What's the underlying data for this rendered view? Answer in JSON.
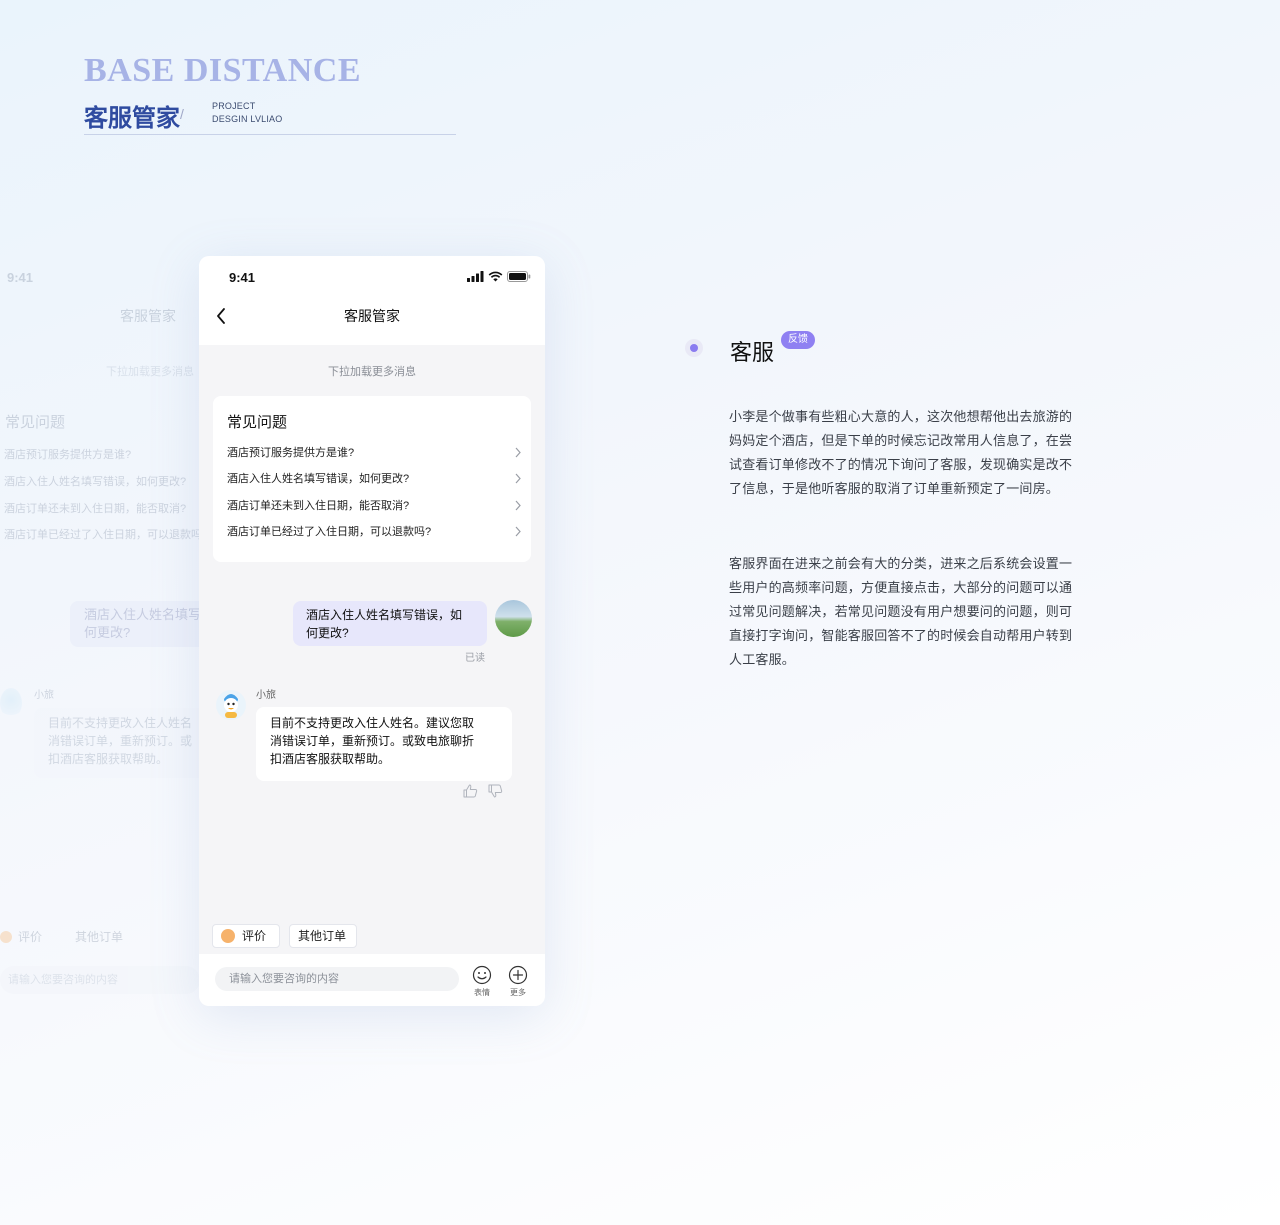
{
  "header": {
    "brand_en": "BASE DISTANCE",
    "brand_cn": "客服管家",
    "slash": "/",
    "sub_line1": "PROJECT",
    "sub_line2": "DESGIN LVLIAO"
  },
  "phone": {
    "status_time": "9:41",
    "nav_title": "客服管家",
    "pull_hint": "下拉加载更多消息",
    "faq": {
      "title": "常见问题",
      "items": [
        "酒店预订服务提供方是谁?",
        "酒店入住人姓名填写错误，如何更改?",
        "酒店订单还未到入住日期，能否取消?",
        "酒店订单已经过了入住日期，可以退款吗?"
      ]
    },
    "user_message": {
      "line1": "酒店入住人姓名填写错误，如",
      "line2": "何更改?",
      "status": "已读"
    },
    "bot": {
      "name": "小旅",
      "line1": "目前不支持更改入住人姓名。建议您取",
      "line2": "消错误订单，重新预订。或致电旅聊折",
      "line3": "扣酒店客服获取帮助。"
    },
    "quick_actions": [
      "评价",
      "其他订单"
    ],
    "input_placeholder": "请输入您要咨询的内容",
    "tools": {
      "emoji": "表情",
      "more": "更多"
    }
  },
  "ghost": {
    "time": "9:41",
    "title": "客服管家",
    "hint": "下拉加载更多消息",
    "faq_title": "常见问题",
    "faq_items": [
      "酒店预订服务提供方是谁?",
      "酒店入住人姓名填写错误，如何更改?",
      "酒店订单还未到入住日期，能否取消?",
      "酒店订单已经过了入住日期，可以退款吗"
    ],
    "bubble_line1": "酒店入住人姓名填写",
    "bubble_line2": "何更改?",
    "bot_name": "小旅",
    "reply_line1": "目前不支持更改入住人姓名",
    "reply_line2": "消错误订单，重新预订。或",
    "reply_line3": "扣酒店客服获取帮助。",
    "chip1": "评价",
    "chip2": "其他订单",
    "input": "请输入您要咨询的内容"
  },
  "annotation": {
    "title": "客服",
    "badge": "反馈",
    "para1": "小李是个做事有些粗心大意的人，这次他想帮他出去旅游的妈妈定个酒店，但是下单的时候忘记改常用人信息了，在尝试查看订单修改不了的情况下询问了客服，发现确实是改不了信息，于是他听客服的取消了订单重新预定了一间房。",
    "para2": "客服界面在进来之前会有大的分类，进来之后系统会设置一些用户的高频率问题，方便直接点击，大部分的问题可以通过常见问题解决，若常见问题没有用户想要问的问题，则可直接打字询问，智能客服回答不了的时候会自动帮用户转到人工客服。"
  },
  "colors": {
    "brand_en": "#a7b3e6",
    "brand_cn": "#2f4ba0",
    "user_bubble": "#e7e7fb",
    "badge": "#8f80f2"
  }
}
